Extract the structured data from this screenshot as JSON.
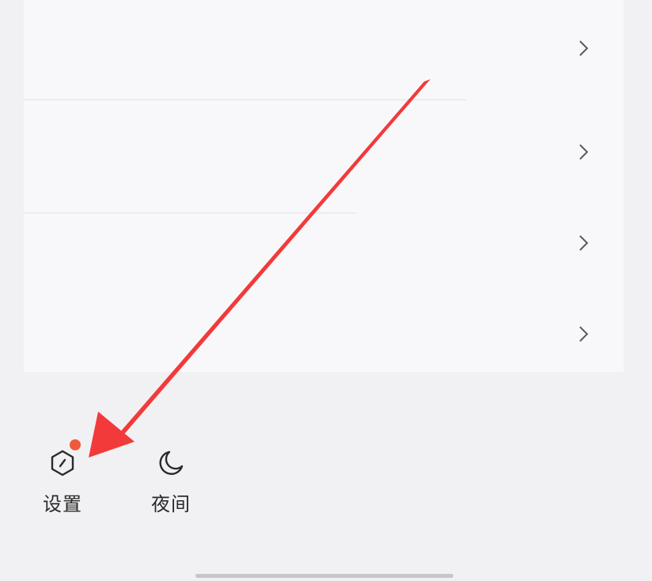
{
  "menu_rows": [
    {
      "chevron_icon": "chevron-right-icon"
    },
    {
      "chevron_icon": "chevron-right-icon"
    },
    {
      "chevron_icon": "chevron-right-icon"
    },
    {
      "chevron_icon": "chevron-right-icon"
    }
  ],
  "footer": {
    "settings": {
      "label": "设置",
      "icon": "settings-hexagon-icon",
      "has_badge": true
    },
    "night": {
      "label": "夜间",
      "icon": "moon-icon"
    }
  },
  "colors": {
    "background": "#f1f1f4",
    "card": "#f8f8fa",
    "badge": "#f05a3c",
    "annotation_arrow": "#f23a3a",
    "icon_stroke": "#2a2a2a",
    "chevron": "#5a5a62"
  },
  "annotation": {
    "type": "arrow",
    "points_to": "settings-button"
  }
}
